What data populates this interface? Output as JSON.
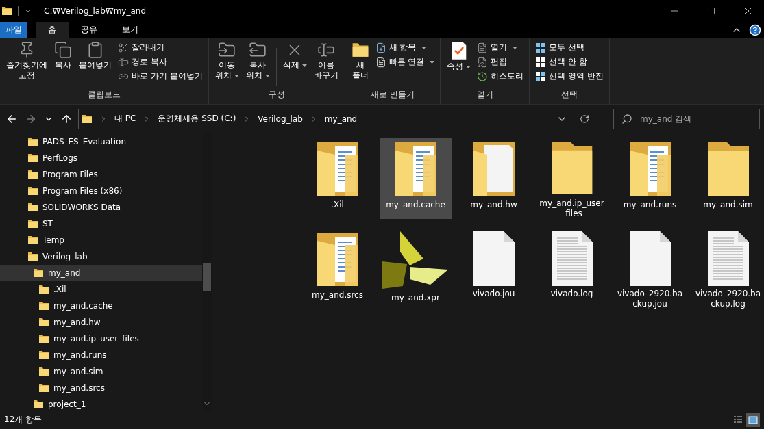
{
  "window": {
    "title": "C:₩Verilog_lab₩my_and"
  },
  "ribbon_tabs": [
    {
      "label": "파일",
      "kind": "file",
      "selected": false
    },
    {
      "label": "홈",
      "kind": "tab",
      "selected": true
    },
    {
      "label": "공유",
      "kind": "tab",
      "selected": false
    },
    {
      "label": "보기",
      "kind": "tab",
      "selected": false
    }
  ],
  "ribbon_groups": [
    {
      "label": "클립보드",
      "columns": [
        {
          "kind": "large",
          "label": "즐겨찾기에\n고정"
        },
        {
          "kind": "large",
          "label": "복사"
        },
        {
          "kind": "large",
          "label": "붙여넣기"
        },
        {
          "kind": "stack",
          "items": [
            {
              "label": "잘라내기"
            },
            {
              "label": "경로 복사"
            },
            {
              "label": "바로 가기 붙여넣기"
            }
          ]
        }
      ]
    },
    {
      "label": "구성",
      "columns": [
        {
          "kind": "large",
          "label": "이동\n위치",
          "dropdown": true
        },
        {
          "kind": "large",
          "label": "복사\n위치",
          "dropdown": true
        },
        {
          "kind": "divider"
        },
        {
          "kind": "large",
          "label": "삭제",
          "dropdown": true
        },
        {
          "kind": "large",
          "label": "이름\n바꾸기"
        }
      ]
    },
    {
      "label": "새로 만들기",
      "columns": [
        {
          "kind": "large",
          "label": "새\n폴더"
        },
        {
          "kind": "stack",
          "items": [
            {
              "label": "새 항목",
              "dropdown": true
            },
            {
              "label": "빠른 연결",
              "dropdown": true
            }
          ]
        }
      ]
    },
    {
      "label": "열기",
      "columns": [
        {
          "kind": "large",
          "label": "속성",
          "dropdown": true
        },
        {
          "kind": "stack",
          "items": [
            {
              "label": "열기",
              "dropdown": true
            },
            {
              "label": "편집"
            },
            {
              "label": "히스토리"
            }
          ]
        }
      ]
    },
    {
      "label": "선택",
      "columns": [
        {
          "kind": "stack",
          "items": [
            {
              "label": "모두 선택"
            },
            {
              "label": "선택 안 함"
            },
            {
              "label": "선택 영역 반전"
            }
          ]
        }
      ]
    }
  ],
  "breadcrumb": [
    "내 PC",
    "운영체제용 SSD (C:)",
    "Verilog_lab",
    "my_and"
  ],
  "search": {
    "placeholder": "my_and 검색"
  },
  "tree": [
    {
      "label": "PADS_ES_Evaluation",
      "selected": false
    },
    {
      "label": "PerfLogs",
      "selected": false
    },
    {
      "label": "Program Files",
      "selected": false
    },
    {
      "label": "Program Files (x86)",
      "selected": false
    },
    {
      "label": "SOLIDWORKS Data",
      "selected": false
    },
    {
      "label": "ST",
      "selected": false
    },
    {
      "label": "Temp",
      "selected": false
    },
    {
      "label": "Verilog_lab",
      "selected": false,
      "children": [
        {
          "label": "my_and",
          "selected": true,
          "children": [
            {
              "label": ".Xil",
              "selected": false
            },
            {
              "label": "my_and.cache",
              "selected": false
            },
            {
              "label": "my_and.hw",
              "selected": false
            },
            {
              "label": "my_and.ip_user_files",
              "selected": false
            },
            {
              "label": "my_and.runs",
              "selected": false
            },
            {
              "label": "my_and.sim",
              "selected": false
            },
            {
              "label": "my_and.srcs",
              "selected": false
            }
          ]
        },
        {
          "label": "project_1",
          "selected": false
        }
      ]
    }
  ],
  "files": [
    {
      "name": ".Xil",
      "kind": "folder-docs",
      "selected": false
    },
    {
      "name": "my_and.cache",
      "kind": "folder-docs",
      "selected": true
    },
    {
      "name": "my_and.hw",
      "kind": "folder-page",
      "selected": false
    },
    {
      "name": "my_and.ip_user_files",
      "kind": "folder",
      "selected": false
    },
    {
      "name": "my_and.runs",
      "kind": "folder-docs",
      "selected": false
    },
    {
      "name": "my_and.sim",
      "kind": "folder",
      "selected": false
    },
    {
      "name": "my_and.srcs",
      "kind": "folder-docs",
      "selected": false
    },
    {
      "name": "my_and.xpr",
      "kind": "vivado",
      "selected": false
    },
    {
      "name": "vivado.jou",
      "kind": "blank-doc",
      "selected": false
    },
    {
      "name": "vivado.log",
      "kind": "lined-doc",
      "selected": false
    },
    {
      "name": "vivado_2920.backup.jou",
      "kind": "blank-doc",
      "selected": false
    },
    {
      "name": "vivado_2920.backup.log",
      "kind": "lined-doc",
      "selected": false
    }
  ],
  "status_bar": {
    "count": "12개 항목"
  },
  "view_buttons": [
    {
      "kind": "details",
      "selected": false
    },
    {
      "kind": "large-icons",
      "selected": true
    }
  ]
}
